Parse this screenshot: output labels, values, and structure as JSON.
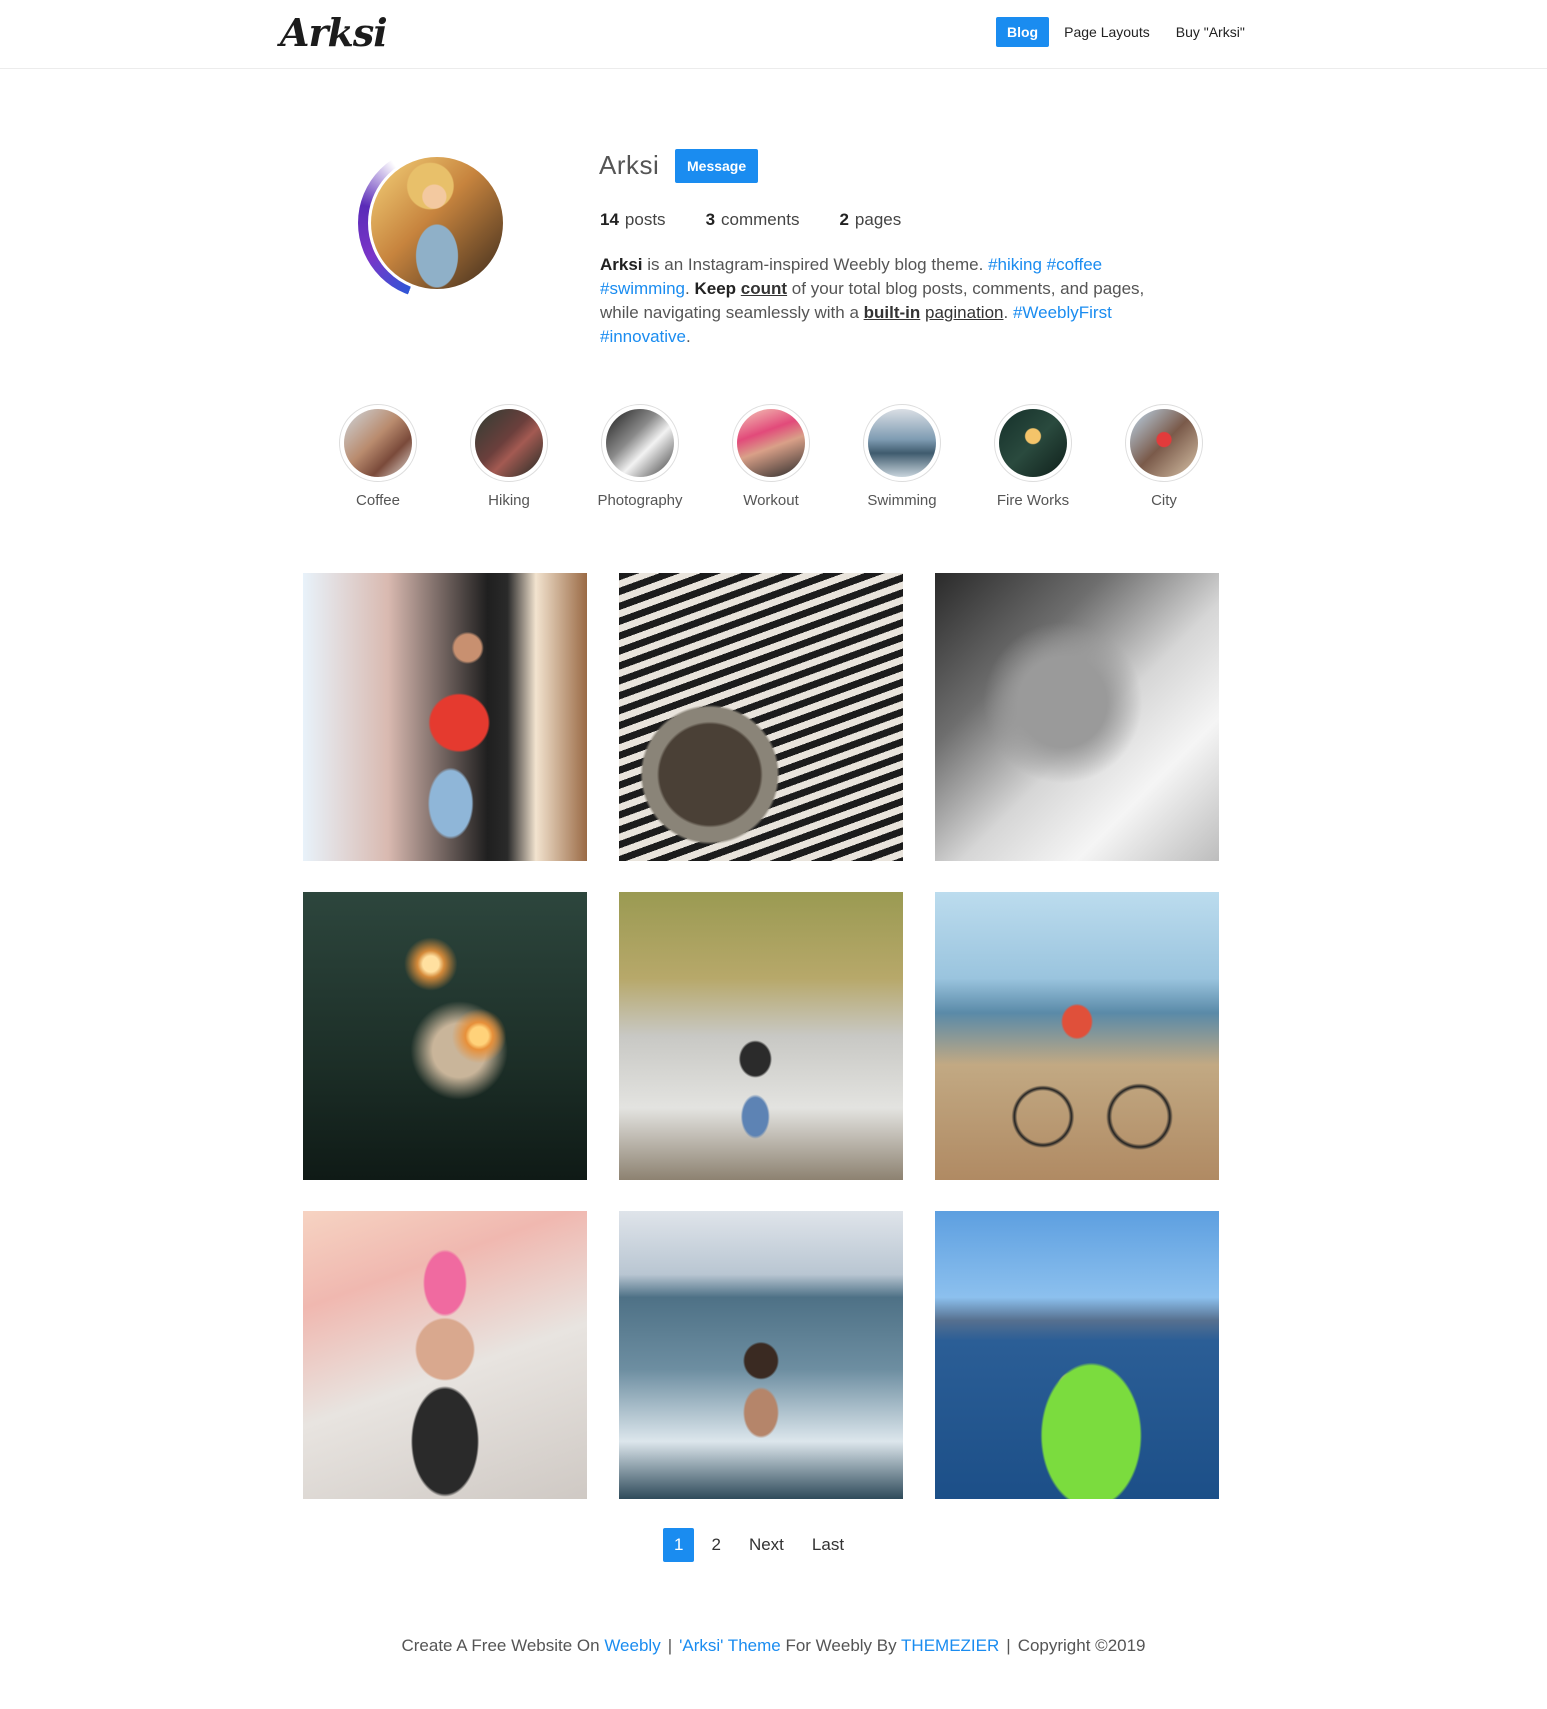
{
  "header": {
    "logo": "Arksi",
    "nav": [
      "Blog",
      "Page Layouts",
      "Buy \"Arksi\""
    ],
    "active_index": 0
  },
  "profile": {
    "name": "Arksi",
    "message_label": "Message",
    "stats": [
      {
        "count": "14",
        "label": "posts"
      },
      {
        "count": "3",
        "label": "comments"
      },
      {
        "count": "2",
        "label": "pages"
      }
    ],
    "bio": {
      "brand": "Arksi",
      "t1": " is an Instagram-inspired Weebly blog theme. ",
      "tag_hiking": "#hiking",
      "tag_coffee": "#coffee",
      "tag_swimming": "#swimming",
      "t2": ". ",
      "keep": "Keep",
      "count": "count",
      "t3": " of your total blog posts, comments, and pages, while navigating seamlessly with a ",
      "builtin": "built-in",
      "pagination": "pagination",
      "t4": ". ",
      "tag_weeblyfirst": "#WeeblyFirst",
      "tag_innovative": "#innovative",
      "t5": "."
    }
  },
  "highlights": [
    "Coffee",
    "Hiking",
    "Photography",
    "Workout",
    "Swimming",
    "Fire Works",
    "City"
  ],
  "posts": [
    "woman-red-infuse-tshirt-storefront",
    "woman-striped-sweater-laundromat",
    "woman-black-white-portrait",
    "woman-sparklers-forest",
    "woman-hiking-backpack-road",
    "woman-bicycle-palm-street",
    "woman-workout-pink-top",
    "woman-swimsuit-ocean-waves",
    "woman-green-kayak-lake"
  ],
  "pagination": {
    "pages": [
      "1",
      "2"
    ],
    "current": "1",
    "next_label": "Next",
    "last_label": "Last"
  },
  "footer": {
    "text1": "Create A Free Website On ",
    "weebly": "Weebly",
    "sep": "|",
    "theme": "'Arksi' Theme",
    "text2": " For Weebly By ",
    "themezier": "THEMEZIER",
    "copyright": "Copyright ©2019"
  },
  "colors": {
    "accent": "#1a8cf0",
    "text": "#555555",
    "dark": "#222222"
  }
}
